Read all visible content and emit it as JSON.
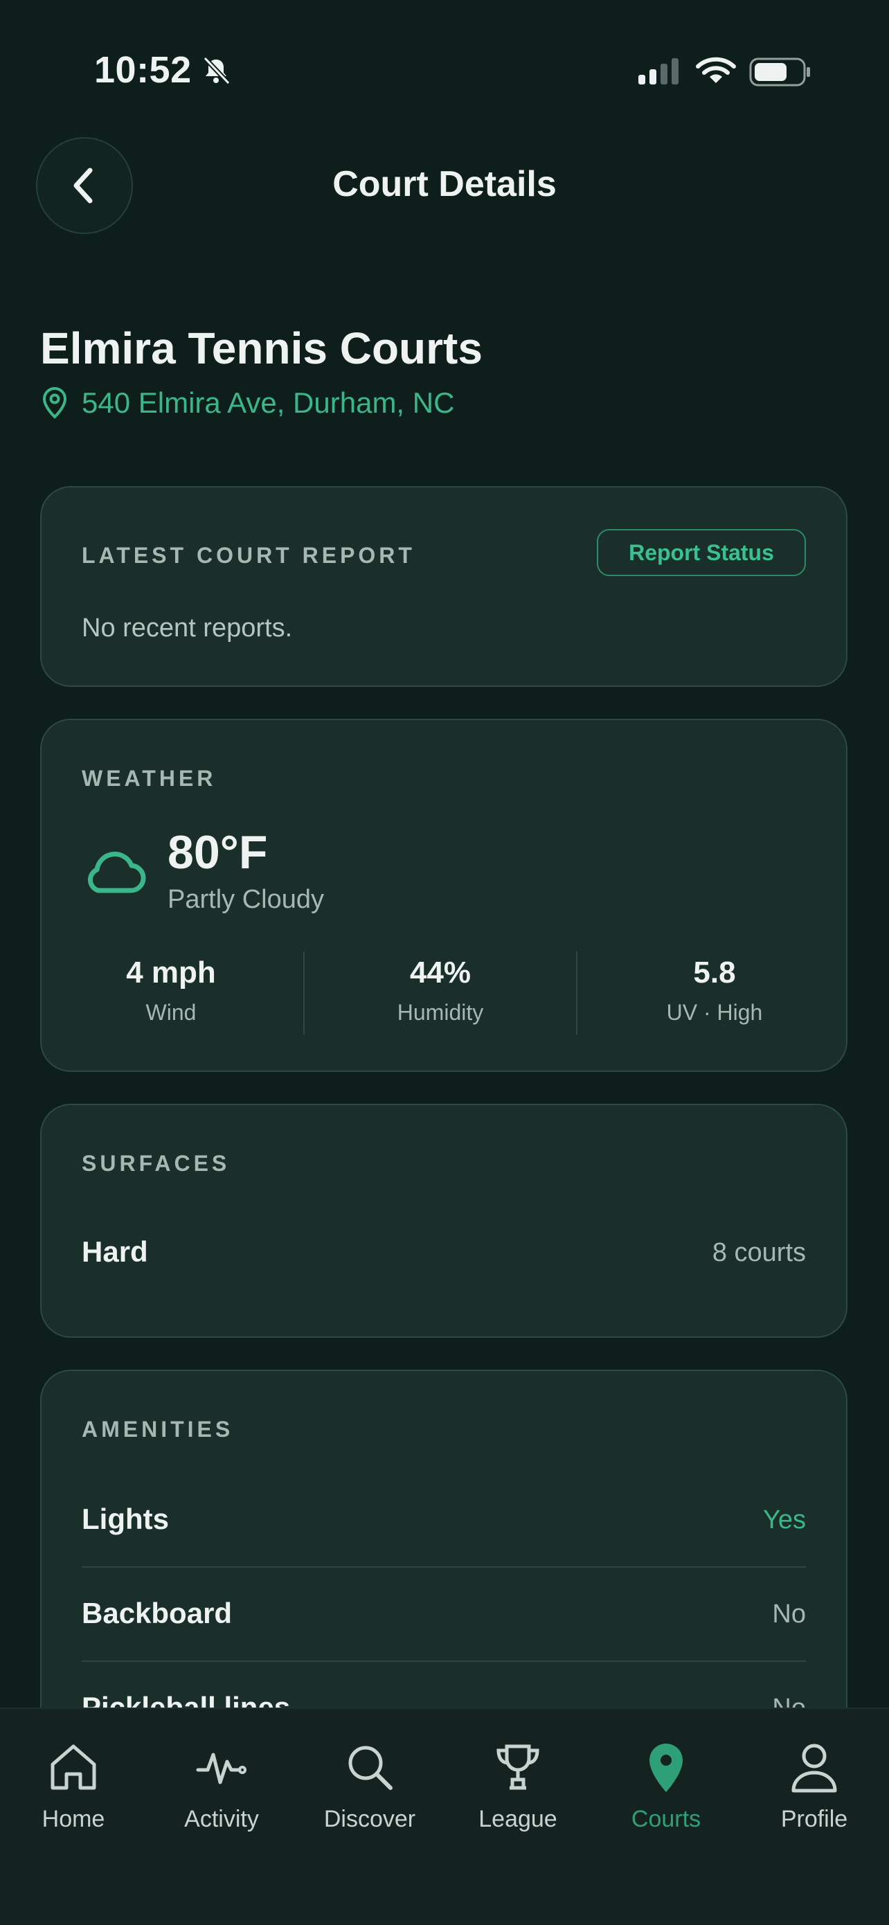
{
  "status_bar": {
    "time": "10:52"
  },
  "header": {
    "title": "Court Details"
  },
  "court": {
    "name": "Elmira Tennis Courts",
    "address": "540 Elmira Ave, Durham, NC"
  },
  "report": {
    "label": "LATEST COURT REPORT",
    "button": "Report Status",
    "text": "No recent reports."
  },
  "weather": {
    "label": "WEATHER",
    "temperature": "80°F",
    "condition": "Partly Cloudy",
    "stats": [
      {
        "value": "4 mph",
        "label": "Wind"
      },
      {
        "value": "44%",
        "label": "Humidity"
      },
      {
        "value": "5.8",
        "label": "UV · High"
      }
    ]
  },
  "surfaces": {
    "label": "SURFACES",
    "items": [
      {
        "name": "Hard",
        "count": "8 courts"
      }
    ]
  },
  "amenities": {
    "label": "AMENITIES",
    "items": [
      {
        "name": "Lights",
        "value": "Yes"
      },
      {
        "name": "Backboard",
        "value": "No"
      },
      {
        "name": "Pickleball lines",
        "value": "No"
      }
    ]
  },
  "tabs": [
    {
      "label": "Home",
      "icon": "home-icon"
    },
    {
      "label": "Activity",
      "icon": "activity-icon"
    },
    {
      "label": "Discover",
      "icon": "search-icon"
    },
    {
      "label": "League",
      "icon": "trophy-icon"
    },
    {
      "label": "Courts",
      "icon": "location-pin-icon",
      "active": true
    },
    {
      "label": "Profile",
      "icon": "person-icon"
    }
  ],
  "colors": {
    "accent": "#3bb58a",
    "background": "#0e1f1b",
    "card": "#1a2e2a"
  }
}
